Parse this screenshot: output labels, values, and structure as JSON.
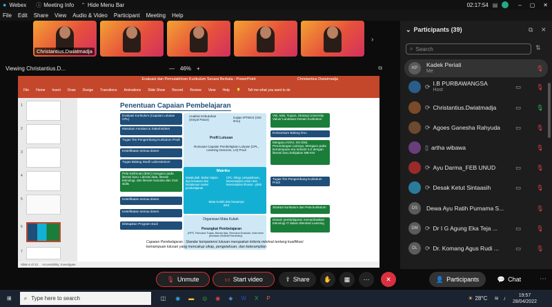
{
  "app": {
    "name": "Webex",
    "meeting_info": "Meeting Info",
    "hide_menu_bar": "Hide Menu Bar",
    "time": "02:17:54"
  },
  "menu": [
    "File",
    "Edit",
    "Share",
    "View",
    "Audio & Video",
    "Participant",
    "Meeting",
    "Help"
  ],
  "video_tiles": [
    {
      "name": "Christantius.Dwiatmadja"
    },
    {
      "name": ""
    },
    {
      "name": ""
    },
    {
      "name": ""
    },
    {
      "name": ""
    }
  ],
  "viewing": {
    "label": "Viewing Christantius.D...",
    "zoom": "46%",
    "zoom_minus": "—",
    "zoom_plus": "+"
  },
  "ppt": {
    "title": "Evaluasi dan Pemutakhiran Kurikulum Secara Berkala  -  PowerPoint",
    "user": "Christantius Dwiatmadja",
    "tabs": [
      "File",
      "Home",
      "Insert",
      "Draw",
      "Design",
      "Transitions",
      "Animations",
      "Slide Show",
      "Record",
      "Review",
      "View",
      "Help"
    ],
    "tell_me": "Tell me what you want to do",
    "thumb_numbers": [
      "1",
      "2",
      "3",
      "4",
      "5",
      "6",
      "7"
    ],
    "status_slide": "Slide 6 of 23",
    "status_accessibility": "Accessibility: Investigate",
    "slide": {
      "title": "Penentuan Capaian Pembelajaran",
      "left_boxes": [
        "Evaluasi Kurikulum (Capaian Lulusan CPL)",
        "Masukan Asosiasi & Stakeholders",
        "Tugas Tim Pengembang Kurikulum Prodi",
        "Keterlibatan semua dosen",
        "Tugas Bidang Studi/ Laboratorium",
        "Peta Keilmuan (BoK) mengacu pada literasi baru: Literasi data, literasi teknologi, dan literasi manusia dan 21st skills",
        "Keterlibatan semua dosen",
        "Keterlibatan semua dosen",
        "Ditetapkan Program studi"
      ],
      "center": {
        "analisis": "Analisis Kebutuhan (Sinyal Pasar)",
        "kajian": "Kajian IPTEKS (Visi Ilmu)",
        "profil": "Profil Lulusan",
        "rumusan": "Rumusan Capaian Pembelajaran Lulusan (CPL, Learning Outcome, LO) Prodi",
        "matriks": "Matriks",
        "matakuliah": "Matakuliah: Bahan kajian dgn keluasan dan kedalaman materi pembelajaran",
        "cpl": "CPL: Sikap, pengetahuan, keterampilan umum dan keterampilan khusus - pilah",
        "mata_kuliah_sks": "Mata Kuliah dan besarnya SKS",
        "organisasi": "Organisasi Mata Kuliah",
        "perangkat": "Perangkat Pembelajaran",
        "perangkat_sub": "(RPS, Rencana Tugas, Bahan Ajar, Rencana Evaluasi, Instrumen penilaian (Rubrik/Portofolio))"
      },
      "right_boxes": [
        "Visi, Misi, Tujuan, Strategi University Value/ Landasan Desain Kurikulum",
        "Konsorsium Bidang Ilmu",
        "Mengacu KKNI, SN Dikti, Perundangan Lainnya, Mengacu pada kemampuan era Industri 4.0 dengan literasi baru kebijakan MB-KM",
        "Tugas Tim Pengembang Kurikulum Prodi",
        "Struktur kurikulum dan Peta kurikulum",
        "Desain pembelajaran memanfaatkan teknologi IT dalam Blended Learning"
      ],
      "caption": "Capaian Pembelajaran : Standar kompetensi lulusan merupakan kriteria minimal tentang kualifikasi kemampuan lulusan yang mencakup sikap, pengetahuan, dan keterampilan"
    }
  },
  "participants_panel": {
    "title": "Participants (39)",
    "search_placeholder": "Search",
    "list": [
      {
        "initials": "KP",
        "name": "Kadek Periati",
        "role": "Me",
        "avatar_color": "#5a5a5a"
      },
      {
        "initials": "",
        "name": "I.B PURBAWANGSA",
        "role": "Host",
        "avatar_color": "#2b5d8a"
      },
      {
        "initials": "",
        "name": "Christantius.Dwiatmadja",
        "role": "",
        "avatar_color": "#7a4b2a"
      },
      {
        "initials": "",
        "name": "Agoes Ganesha Rahyuda",
        "role": "",
        "avatar_color": "#6b4a2e"
      },
      {
        "initials": "",
        "name": "artha wibawa",
        "role": "",
        "avatar_color": "#6a3e7a"
      },
      {
        "initials": "",
        "name": "Ayu Darma_FEB UNUD",
        "role": "",
        "avatar_color": "#9b2a2a"
      },
      {
        "initials": "",
        "name": "Desak Ketut Sintaasih",
        "role": "",
        "avatar_color": "#2a7a9b"
      },
      {
        "initials": "DS",
        "name": "Dewa Ayu Ratih Purnama S...",
        "role": "",
        "avatar_color": "#5a5a5a"
      },
      {
        "initials": "DM",
        "name": "Dr I G Agung Eka Teja ...",
        "role": "",
        "avatar_color": "#5a5a5a"
      },
      {
        "initials": "DL",
        "name": "Dr. Komang Agus Rudi ...",
        "role": "",
        "avatar_color": "#5a5a5a"
      }
    ]
  },
  "controls": {
    "unmute": "Unmute",
    "start_video": "Start video",
    "share": "Share",
    "participants": "Participants",
    "chat": "Chat"
  },
  "taskbar": {
    "search_placeholder": "Type here to search",
    "temp": "28°C",
    "time": "19:57",
    "date": "28/04/2022"
  },
  "colors": {
    "accent_red": "#d9303f",
    "green_mic": "#2ebd59",
    "muted_red": "#e2434f",
    "ppt_red": "#c4472b"
  }
}
